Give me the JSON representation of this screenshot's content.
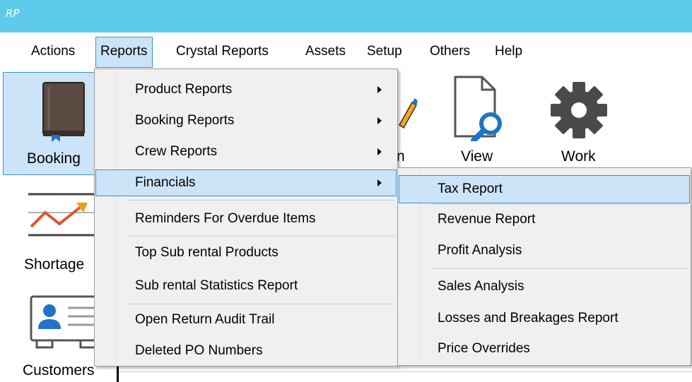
{
  "app": {
    "logo_text": "RP"
  },
  "menubar": {
    "items": [
      {
        "label": "Actions"
      },
      {
        "label": "Reports"
      },
      {
        "label": "Crystal Reports"
      },
      {
        "label": "Assets"
      },
      {
        "label": "Setup"
      },
      {
        "label": "Others"
      },
      {
        "label": "Help"
      }
    ]
  },
  "toolbar": {
    "booking": {
      "label": "Booking",
      "icon": "book-icon"
    },
    "view": {
      "label": "View",
      "icon": "document-search-icon"
    },
    "work": {
      "label": "Work",
      "icon": "gear-icon"
    },
    "partial_label": "n",
    "shortage": {
      "label": "Shortage",
      "icon": "trend-chart-icon"
    },
    "customers": {
      "label": "Customers",
      "icon": "contact-card-icon"
    }
  },
  "reports_menu": {
    "items": [
      {
        "label": "Product Reports",
        "has_submenu": true
      },
      {
        "label": "Booking Reports",
        "has_submenu": true
      },
      {
        "label": "Crew Reports",
        "has_submenu": true
      },
      {
        "label": "Financials",
        "has_submenu": true
      },
      {
        "label": "Reminders For Overdue Items"
      },
      {
        "label": "Top Sub rental Products"
      },
      {
        "label": "Sub rental Statistics Report"
      },
      {
        "label": "Open Return Audit Trail"
      },
      {
        "label": "Deleted PO Numbers"
      }
    ]
  },
  "financials_menu": {
    "items": [
      {
        "label": "Tax Report"
      },
      {
        "label": "Revenue Report"
      },
      {
        "label": "Profit Analysis"
      },
      {
        "label": "Sales Analysis"
      },
      {
        "label": "Losses and Breakages Report"
      },
      {
        "label": "Price Overrides"
      }
    ]
  },
  "colors": {
    "titlebar": "#5ecbea",
    "highlight_bg": "#cce4f7",
    "highlight_border": "#3c8fd4",
    "menu_bg": "#f0f0f0"
  }
}
